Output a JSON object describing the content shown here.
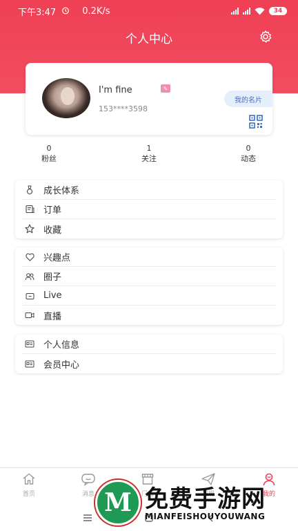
{
  "status_bar": {
    "time": "下午3:47",
    "network_speed": "0.2K/s",
    "battery": "34"
  },
  "header": {
    "title": "个人中心"
  },
  "profile": {
    "nickname": "I'm fine",
    "phone": "153****3598",
    "card_button": "我的名片"
  },
  "stats": [
    {
      "value": "0",
      "label": "粉丝"
    },
    {
      "value": "1",
      "label": "关注"
    },
    {
      "value": "0",
      "label": "动态"
    }
  ],
  "menu_groups": [
    [
      {
        "label": "成长体系",
        "icon": "medal-icon"
      },
      {
        "label": "订单",
        "icon": "order-icon"
      },
      {
        "label": "收藏",
        "icon": "star-icon"
      }
    ],
    [
      {
        "label": "兴趣点",
        "icon": "heart-icon"
      },
      {
        "label": "圈子",
        "icon": "people-icon"
      },
      {
        "label": "Live",
        "icon": "tv-icon"
      },
      {
        "label": "直播",
        "icon": "video-icon"
      }
    ],
    [
      {
        "label": "个人信息",
        "icon": "id-card-icon"
      },
      {
        "label": "会员中心",
        "icon": "id-card-icon"
      }
    ]
  ],
  "bottom_nav": [
    {
      "label": "首页",
      "icon": "home-icon"
    },
    {
      "label": "消息",
      "icon": "message-icon"
    },
    {
      "label": "门店",
      "icon": "store-icon"
    },
    {
      "label": "发现",
      "icon": "paper-plane-icon"
    },
    {
      "label": "我的",
      "icon": "user-icon"
    }
  ],
  "watermark": {
    "logo_letter": "M",
    "title": "免费手游网",
    "subtitle": "MIANFEISHOUYOUWANG"
  },
  "colors": {
    "header": "#ef3f55",
    "accent_blue": "#4a6fb5",
    "watermark_green": "#1f9a55"
  }
}
